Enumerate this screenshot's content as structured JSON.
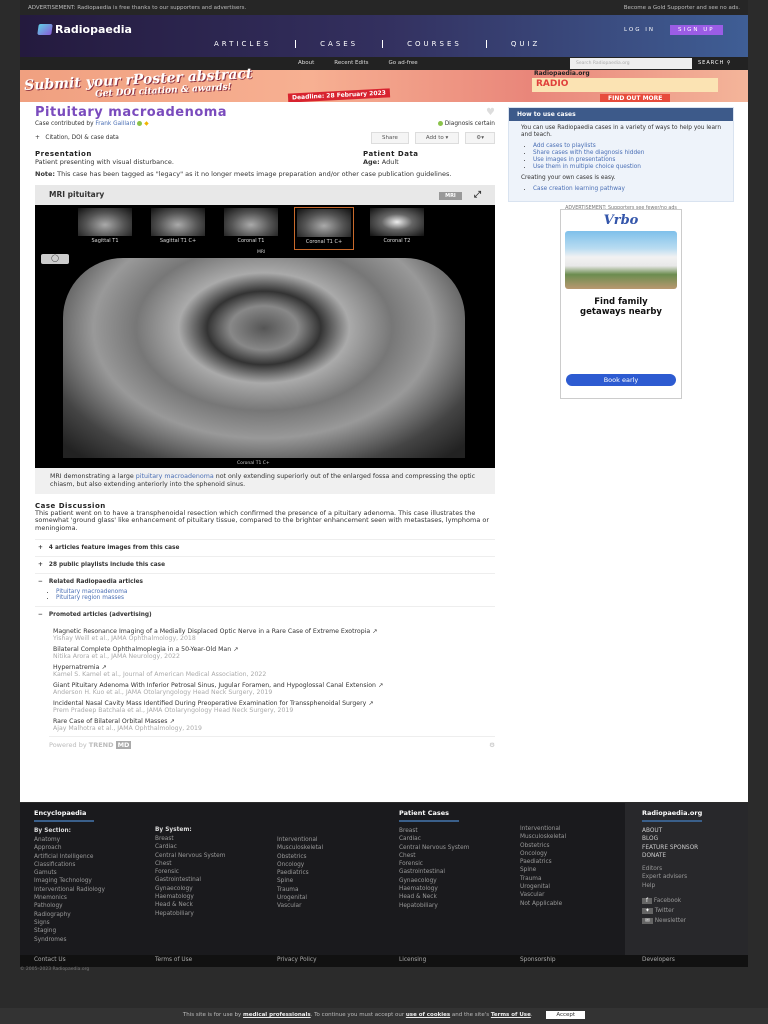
{
  "topbar": {
    "ad_text": "ADVERTISEMENT: Radiopaedia is free thanks to our supporters and advertisers.",
    "gold": "Become a Gold Supporter and see no ads."
  },
  "header": {
    "logo": "Radiopaedia",
    "nav": [
      "ARTICLES",
      "CASES",
      "COURSES",
      "QUIZ"
    ],
    "login": "LOG IN",
    "signup": "SIGN UP"
  },
  "subnav": {
    "links": [
      "About",
      "Recent Edits",
      "Go ad-free"
    ],
    "search_placeholder": "Search Radiopaedia.org",
    "search_button": "SEARCH"
  },
  "banner": {
    "line1": "Submit your rPoster abstract",
    "line2": "Get DOI citation & awards!",
    "deadline": "Deadline: 28 February 2023",
    "brand": "Radiopaedia.org",
    "radio": "RADIO",
    "cta": "FIND OUT MORE"
  },
  "case": {
    "title": "Pituitary macroadenoma",
    "contributed_prefix": "Case contributed by",
    "author": "Frank Gaillard",
    "diagnosis": "Diagnosis certain",
    "citation": "Citation, DOI & case data",
    "share": "Share",
    "add_to": "Add to",
    "presentation_h": "Presentation",
    "presentation": "Patient presenting with visual disturbance.",
    "patient_data_h": "Patient Data",
    "age_label": "Age:",
    "age": "Adult",
    "note_label": "Note:",
    "note": "This case has been tagged as \"legacy\" as it no longer meets image preparation and/or other case publication guidelines."
  },
  "viewer": {
    "title": "MRI pituitary",
    "badge": "MRI",
    "modality": "MRI",
    "thumbs": [
      "Sagittal T1",
      "Sagittal T1 C+",
      "Coronal T1",
      "Coronal T1 C+",
      "Coronal T2"
    ],
    "selected": 3,
    "series_label": "Coronal T1 C+",
    "caption_pre": "MRI demonstrating a large",
    "caption_link": "pituitary macroadenoma",
    "caption_post": "not only extending superiorly out of the enlarged fossa and compressing the optic chiasm, but also extending anteriorly into the sphenoid sinus."
  },
  "discussion": {
    "title": "Case Discussion",
    "text": "This patient went on to have a transphenoidal resection which confirmed the presence of a pituitary adenoma. This case illustrates the somewhat 'ground glass' like enhancement of pituitary tissue, compared to the brighter enhancement seen with metastases, lymphoma or meningioma."
  },
  "accordions": {
    "a1": "4 articles feature images from this case",
    "a2": "28 public playlists include this case",
    "a3": "Related Radiopaedia articles",
    "a3_items": [
      "Pituitary macroadenoma",
      "Pituitary region masses"
    ],
    "a4": "Promoted articles (advertising)"
  },
  "promoted": [
    {
      "title": "Magnetic Resonance Imaging of a Medially Displaced Optic Nerve in a Rare Case of Extreme Exotropia",
      "meta": "Yishay Weill et al., JAMA Ophthalmology, 2018"
    },
    {
      "title": "Bilateral Complete Ophthalmoplegia in a 50-Year-Old Man",
      "meta": "Nitika Arora et al., JAMA Neurology, 2022"
    },
    {
      "title": "Hypernatremia",
      "meta": "Kamel S. Kamel et al., Journal of American Medical Association, 2022"
    },
    {
      "title": "Giant Pituitary Adenoma With Inferior Petrosal Sinus, Jugular Foramen, and Hypoglossal Canal Extension",
      "meta": "Anderson H. Kuo et al., JAMA Otolaryngology Head Neck Surgery, 2019"
    },
    {
      "title": "Incidental Nasal Cavity Mass Identified During Preoperative Examination for Transsphenoidal Surgery",
      "meta": "Prem Pradeep Batchala et al., JAMA Otolaryngology Head Neck Surgery, 2019"
    },
    {
      "title": "Rare Case of Bilateral Orbital Masses",
      "meta": "Ajay Malhotra et al., JAMA Ophthalmology, 2019"
    }
  ],
  "trendmd": {
    "powered": "Powered by",
    "brand": "TREND",
    "md": "MD"
  },
  "sidebar": {
    "title": "How to use cases",
    "intro": "You can use Radiopaedia cases in a variety of ways to help you learn and teach.",
    "items": [
      "Add cases to playlists",
      "Share cases with the diagnosis hidden",
      "Use images in presentations",
      "Use them in multiple choice question"
    ],
    "create": "Creating your own cases is easy.",
    "pathway": "Case creation learning pathway",
    "ad_label": "ADVERTISEMENT: Supporters see fewer/no ads",
    "ad": {
      "brand": "Vrbo",
      "headline": "Find family getaways nearby",
      "cta": "Book early"
    }
  },
  "footer": {
    "ency": "Encyclopaedia",
    "by_section": "By Section:",
    "sections": [
      "Anatomy",
      "Approach",
      "Artificial Intelligence",
      "Classifications",
      "Gamuts",
      "Imaging Technology",
      "Interventional Radiology",
      "Mnemonics",
      "Pathology",
      "Radiography",
      "Signs",
      "Staging",
      "Syndromes"
    ],
    "by_system": "By System:",
    "systems1": [
      "Breast",
      "Cardiac",
      "Central Nervous System",
      "Chest",
      "Forensic",
      "Gastrointestinal",
      "Gynaecology",
      "Haematology",
      "Head & Neck",
      "Hepatobiliary"
    ],
    "systems2": [
      "Interventional",
      "Musculoskeletal",
      "Obstetrics",
      "Oncology",
      "Paediatrics",
      "Spine",
      "Trauma",
      "Urogenital",
      "Vascular"
    ],
    "cases": "Patient Cases",
    "cases1": [
      "Breast",
      "Cardiac",
      "Central Nervous System",
      "Chest",
      "Forensic",
      "Gastrointestinal",
      "Gynaecology",
      "Haematology",
      "Head & Neck",
      "Hepatobiliary"
    ],
    "cases2": [
      "Interventional",
      "Musculoskeletal",
      "Obstetrics",
      "Oncology",
      "Paediatrics",
      "Spine",
      "Trauma",
      "Urogenital",
      "Vascular",
      "Not Applicable"
    ],
    "org": "Radiopaedia.org",
    "org1": [
      "ABOUT",
      "BLOG",
      "FEATURE SPONSOR",
      "DONATE"
    ],
    "org2": [
      "Editors",
      "Expert advisers",
      "Help"
    ],
    "social": [
      "Facebook",
      "Twitter",
      "Newsletter"
    ],
    "bottom": [
      "Contact Us",
      "Terms of Use",
      "Privacy Policy",
      "Licensing",
      "Sponsorship",
      "Developers"
    ],
    "copyright": "© 2005–2023 Radiopaedia.org"
  },
  "cookie": {
    "t1": "This site is for use by",
    "b1": "medical professionals",
    "t2": ". To continue you must accept our",
    "b2": "use of cookies",
    "t3": "and the site's",
    "b3": "Terms of Use",
    "accept": "Accept"
  }
}
